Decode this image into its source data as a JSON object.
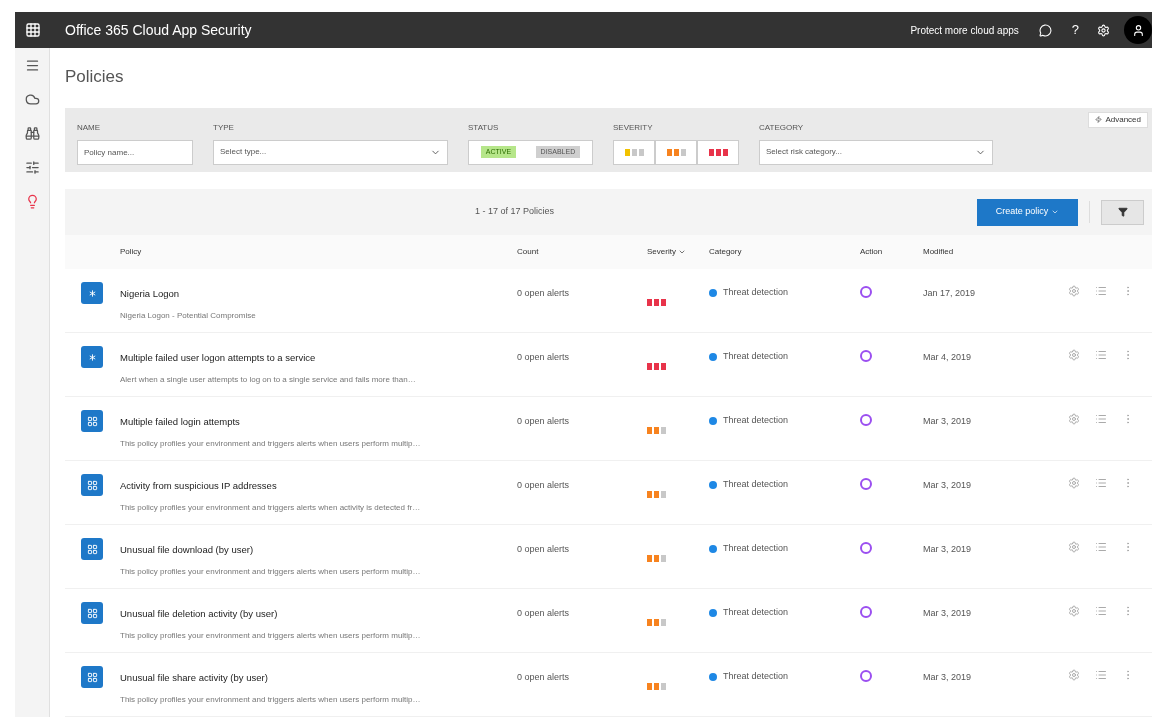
{
  "topbar": {
    "title": "Office 365 Cloud App Security",
    "link": "Protect more cloud apps",
    "help": "?"
  },
  "sidebar": {
    "items": [
      {
        "kind": "menu",
        "selected": false
      },
      {
        "kind": "cloud",
        "selected": false
      },
      {
        "kind": "investigate",
        "selected": false
      },
      {
        "kind": "control",
        "selected": false
      },
      {
        "kind": "alerts",
        "selected": false
      }
    ]
  },
  "page_title": "Policies",
  "filters": {
    "advanced": "Advanced",
    "name": {
      "label": "NAME",
      "placeholder": "Policy name..."
    },
    "type": {
      "label": "TYPE",
      "placeholder": "Select type..."
    },
    "status": {
      "label": "STATUS",
      "options": [
        {
          "label": "ACTIVE",
          "selected": true
        },
        {
          "label": "DISABLED",
          "selected": false
        }
      ]
    },
    "severity": {
      "label": "SEVERITY",
      "options": [
        {
          "stars": 1,
          "selected": false
        },
        {
          "stars": 2,
          "selected": false
        },
        {
          "stars": 3,
          "selected": false
        }
      ]
    },
    "category": {
      "label": "CATEGORY",
      "placeholder": "Select risk category..."
    }
  },
  "toolbar": {
    "count": "1 - 17 of 17 Policies",
    "create": "Create policy"
  },
  "table": {
    "columns": [
      {
        "label": "Policy",
        "sorted": false
      },
      {
        "label": "Count",
        "sorted": false
      },
      {
        "label": "Severity",
        "sorted": true
      },
      {
        "label": "Category",
        "sorted": false
      },
      {
        "label": "Action",
        "sorted": false
      },
      {
        "label": "Modified",
        "sorted": false
      }
    ],
    "rows": [
      {
        "kind": "custom",
        "name": "Nigeria Logon",
        "description": "Nigeria Logon - Potential Compromise",
        "count": "0 open alerts",
        "stars": 3,
        "category": "Threat detection",
        "modified": "Jan 17, 2019"
      },
      {
        "kind": "custom",
        "name": "Multiple failed user logon attempts to a service",
        "description": "Alert when a single user attempts to log on to a single service and fails more than…",
        "count": "0 open alerts",
        "stars": 3,
        "category": "Threat detection",
        "modified": "Mar 4, 2019"
      },
      {
        "kind": "template",
        "name": "Multiple failed login attempts",
        "description": "This policy profiles your environment and triggers alerts when users perform multip…",
        "count": "0 open alerts",
        "stars": 2,
        "category": "Threat detection",
        "modified": "Mar 3, 2019"
      },
      {
        "kind": "template",
        "name": "Activity from suspicious IP addresses",
        "description": "This policy profiles your environment and triggers alerts when activity is detected fr…",
        "count": "0 open alerts",
        "stars": 2,
        "category": "Threat detection",
        "modified": "Mar 3, 2019"
      },
      {
        "kind": "template",
        "name": "Unusual file download (by user)",
        "description": "This policy profiles your environment and triggers alerts when users perform multip…",
        "count": "0 open alerts",
        "stars": 2,
        "category": "Threat detection",
        "modified": "Mar 3, 2019"
      },
      {
        "kind": "template",
        "name": "Unusual file deletion activity (by user)",
        "description": "This policy profiles your environment and triggers alerts when users perform multip…",
        "count": "0 open alerts",
        "stars": 2,
        "category": "Threat detection",
        "modified": "Mar 3, 2019"
      },
      {
        "kind": "template",
        "name": "Unusual file share activity (by user)",
        "description": "This policy profiles your environment and triggers alerts when users perform multip…",
        "count": "0 open alerts",
        "stars": 2,
        "category": "Threat detection",
        "modified": "Mar 3, 2019"
      }
    ]
  }
}
